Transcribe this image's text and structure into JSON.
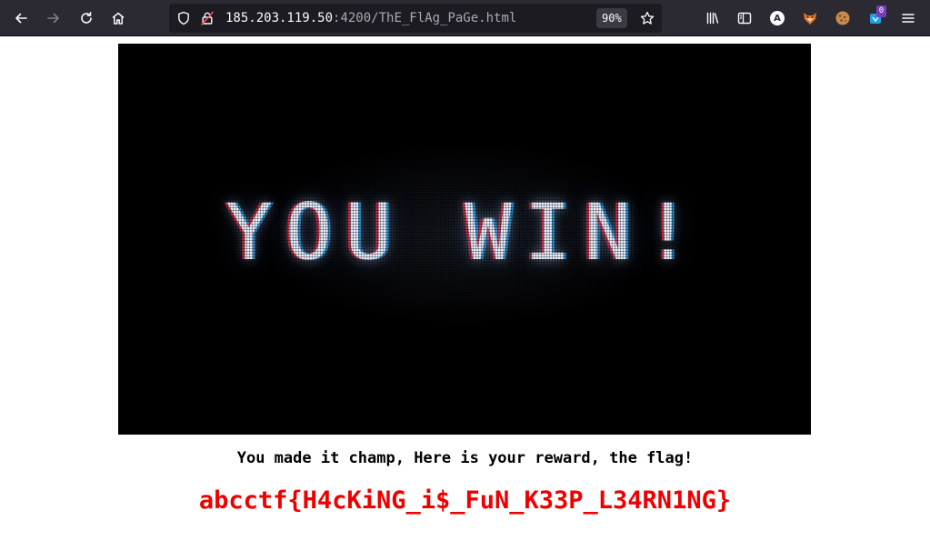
{
  "browser": {
    "url": {
      "host": "185.203.119.50",
      "path": ":4200/ThE_FlAg_PaGe.html"
    },
    "zoom": "90%",
    "toolbar_icons": [
      "back-arrow-icon",
      "forward-arrow-icon",
      "reload-icon",
      "home-icon",
      "shield-icon",
      "insecure-lock-icon",
      "bookmark-star-icon",
      "library-icon",
      "sidebar-icon",
      "account-avatar-icon",
      "extension-fox-icon",
      "extension-cookie-icon",
      "extension-counter-icon",
      "menu-hamburger-icon"
    ],
    "account_initial": "A",
    "extension_badge": "0"
  },
  "page": {
    "banner_text": "YOU WIN!",
    "reward_text": "You made it champ, Here is your reward, the flag!",
    "flag": "abcctf{H4cKiNG_i$_FuN_K33P_L34RN1NG}"
  },
  "colors": {
    "toolbar_bg": "#2b2a33",
    "urlbar_bg": "#1c1b22",
    "flag_red": "#ee0000",
    "screen_bg": "#000000"
  }
}
